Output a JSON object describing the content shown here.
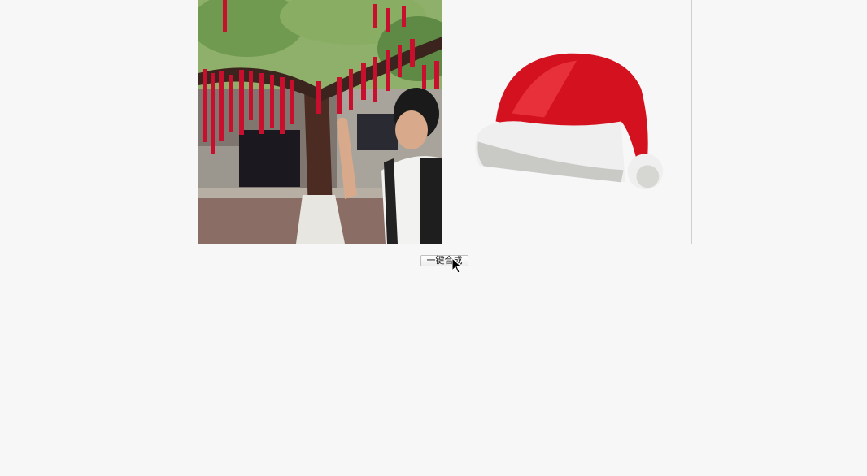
{
  "images": {
    "photo_icon": "photo-icon",
    "hat_icon": "santa-hat-icon"
  },
  "actions": {
    "merge_label": "一键合成"
  },
  "cursor_icon": "mouse-pointer-icon",
  "colors": {
    "page_bg": "#f7f7f7",
    "hat_red": "#d4111e",
    "hat_white": "#efefef",
    "ribbon_red": "#c8102e"
  }
}
